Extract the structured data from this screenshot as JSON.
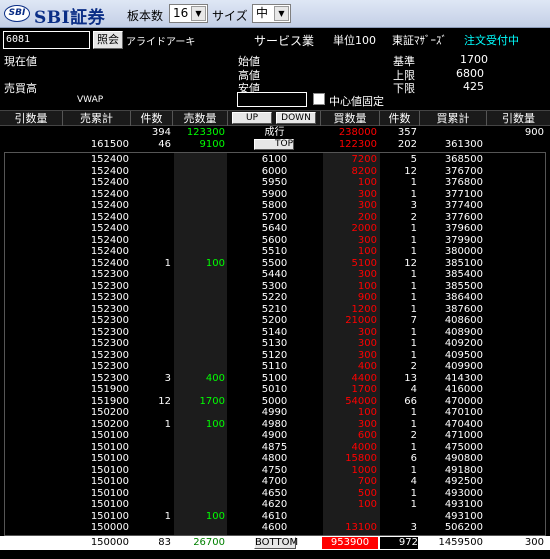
{
  "header": {
    "logo_badge": "SBI",
    "logo_text": "SBI証券",
    "board_count_label": "板本数",
    "board_count_value": "16",
    "size_label": "サイズ",
    "size_value": "中"
  },
  "stock": {
    "code": "6081",
    "lookup_label": "照会",
    "name": "アライドアーキ",
    "sector": "サービス業",
    "unit": "単位100",
    "market": "東証ﾏｻﾞｰｽﾞ",
    "order_status": "注文受付中"
  },
  "prices": {
    "current_label": "現在値",
    "open_label": "始値",
    "high_label": "高値",
    "low_label": "安値",
    "base_label": "基準",
    "base_value": "1700",
    "upper_label": "上限",
    "upper_value": "6800",
    "lower_label": "下限",
    "lower_value": "425",
    "volume_label": "売買高",
    "vwap_label": "VWAP",
    "center_fix_label": "中心値固定"
  },
  "columns": {
    "sell_cancel": "引数量",
    "sell_cum": "売累計",
    "sell_count": "件数",
    "sell_qty": "売数量",
    "up": "UP",
    "down": "DOWN",
    "buy_qty": "買数量",
    "buy_count": "件数",
    "buy_cum": "買累計",
    "buy_cancel": "引数量"
  },
  "top_rows": [
    {
      "sell_count": "394",
      "sell_qty": "123300",
      "price": "成行",
      "buy_qty": "238000",
      "buy_count": "357",
      "buy_cum": "",
      "buy_cancel": "900"
    },
    {
      "sell_cum": "161500",
      "sell_count": "46",
      "sell_qty": "9100",
      "price": "TOP",
      "buy_qty": "122300",
      "buy_count": "202",
      "buy_cum": "361300"
    }
  ],
  "rows": [
    {
      "sc": "152400",
      "n": "",
      "sq": "",
      "p": "6100",
      "bq": "7200",
      "bn": "5",
      "bc": "368500"
    },
    {
      "sc": "152400",
      "n": "",
      "sq": "",
      "p": "6000",
      "bq": "8200",
      "bn": "12",
      "bc": "376700"
    },
    {
      "sc": "152400",
      "n": "",
      "sq": "",
      "p": "5950",
      "bq": "100",
      "bn": "1",
      "bc": "376800"
    },
    {
      "sc": "152400",
      "n": "",
      "sq": "",
      "p": "5900",
      "bq": "300",
      "bn": "1",
      "bc": "377100"
    },
    {
      "sc": "152400",
      "n": "",
      "sq": "",
      "p": "5800",
      "bq": "300",
      "bn": "3",
      "bc": "377400"
    },
    {
      "sc": "152400",
      "n": "",
      "sq": "",
      "p": "5700",
      "bq": "200",
      "bn": "2",
      "bc": "377600"
    },
    {
      "sc": "152400",
      "n": "",
      "sq": "",
      "p": "5640",
      "bq": "2000",
      "bn": "1",
      "bc": "379600"
    },
    {
      "sc": "152400",
      "n": "",
      "sq": "",
      "p": "5600",
      "bq": "300",
      "bn": "1",
      "bc": "379900"
    },
    {
      "sc": "152400",
      "n": "",
      "sq": "",
      "p": "5510",
      "bq": "100",
      "bn": "1",
      "bc": "380000"
    },
    {
      "sc": "152400",
      "n": "1",
      "sq": "100",
      "p": "5500",
      "bq": "5100",
      "bn": "12",
      "bc": "385100"
    },
    {
      "sc": "152300",
      "n": "",
      "sq": "",
      "p": "5440",
      "bq": "300",
      "bn": "1",
      "bc": "385400"
    },
    {
      "sc": "152300",
      "n": "",
      "sq": "",
      "p": "5300",
      "bq": "100",
      "bn": "1",
      "bc": "385500"
    },
    {
      "sc": "152300",
      "n": "",
      "sq": "",
      "p": "5220",
      "bq": "900",
      "bn": "1",
      "bc": "386400"
    },
    {
      "sc": "152300",
      "n": "",
      "sq": "",
      "p": "5210",
      "bq": "1200",
      "bn": "1",
      "bc": "387600"
    },
    {
      "sc": "152300",
      "n": "",
      "sq": "",
      "p": "5200",
      "bq": "21000",
      "bn": "7",
      "bc": "408600"
    },
    {
      "sc": "152300",
      "n": "",
      "sq": "",
      "p": "5140",
      "bq": "300",
      "bn": "1",
      "bc": "408900"
    },
    {
      "sc": "152300",
      "n": "",
      "sq": "",
      "p": "5130",
      "bq": "300",
      "bn": "1",
      "bc": "409200"
    },
    {
      "sc": "152300",
      "n": "",
      "sq": "",
      "p": "5120",
      "bq": "300",
      "bn": "1",
      "bc": "409500"
    },
    {
      "sc": "152300",
      "n": "",
      "sq": "",
      "p": "5110",
      "bq": "400",
      "bn": "2",
      "bc": "409900"
    },
    {
      "sc": "152300",
      "n": "3",
      "sq": "400",
      "p": "5100",
      "bq": "4400",
      "bn": "13",
      "bc": "414300"
    },
    {
      "sc": "151900",
      "n": "",
      "sq": "",
      "p": "5010",
      "bq": "1700",
      "bn": "4",
      "bc": "416000"
    },
    {
      "sc": "151900",
      "n": "12",
      "sq": "1700",
      "p": "5000",
      "bq": "54000",
      "bn": "66",
      "bc": "470000"
    },
    {
      "sc": "150200",
      "n": "",
      "sq": "",
      "p": "4990",
      "bq": "100",
      "bn": "1",
      "bc": "470100"
    },
    {
      "sc": "150200",
      "n": "1",
      "sq": "100",
      "p": "4980",
      "bq": "300",
      "bn": "1",
      "bc": "470400"
    },
    {
      "sc": "150100",
      "n": "",
      "sq": "",
      "p": "4900",
      "bq": "600",
      "bn": "2",
      "bc": "471000"
    },
    {
      "sc": "150100",
      "n": "",
      "sq": "",
      "p": "4875",
      "bq": "4000",
      "bn": "1",
      "bc": "475000"
    },
    {
      "sc": "150100",
      "n": "",
      "sq": "",
      "p": "4800",
      "bq": "15800",
      "bn": "6",
      "bc": "490800"
    },
    {
      "sc": "150100",
      "n": "",
      "sq": "",
      "p": "4750",
      "bq": "1000",
      "bn": "1",
      "bc": "491800"
    },
    {
      "sc": "150100",
      "n": "",
      "sq": "",
      "p": "4700",
      "bq": "700",
      "bn": "4",
      "bc": "492500"
    },
    {
      "sc": "150100",
      "n": "",
      "sq": "",
      "p": "4650",
      "bq": "500",
      "bn": "1",
      "bc": "493000"
    },
    {
      "sc": "150100",
      "n": "",
      "sq": "",
      "p": "4620",
      "bq": "100",
      "bn": "1",
      "bc": "493100"
    },
    {
      "sc": "150100",
      "n": "1",
      "sq": "100",
      "p": "4610",
      "bq": "",
      "bn": "",
      "bc": "493100"
    },
    {
      "sc": "150000",
      "n": "",
      "sq": "",
      "p": "4600",
      "bq": "13100",
      "bn": "3",
      "bc": "506200"
    }
  ],
  "footer": {
    "sell_cum": "150000",
    "sell_count": "83",
    "sell_qty": "26700",
    "bottom_label": "BOTTOM",
    "buy_qty": "953900",
    "buy_count": "972",
    "buy_cum": "1459500",
    "buy_cancel": "300"
  },
  "colors": {
    "header_bg": "#c3cfe6",
    "brand_blue": "#0b2e86",
    "order_status": "#00ffff",
    "sell_qty": "#00ff00",
    "buy_qty": "#ff0000"
  }
}
